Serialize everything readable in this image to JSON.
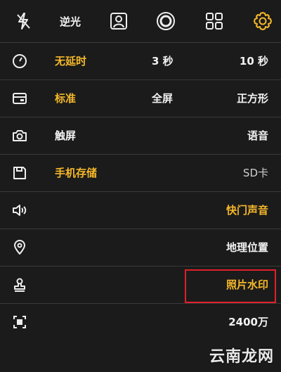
{
  "topbar": {
    "flash_icon": "flash-off-icon",
    "backlight_label": "逆光",
    "portrait_icon": "portrait-icon",
    "shutter_icon": "shutter-ring-icon",
    "grid_icon": "grid-icon",
    "settings_icon": "gear-icon",
    "accent_color": "#f5b82a"
  },
  "rows": {
    "timer": {
      "icon": "timer-icon",
      "options": [
        "无延时",
        "3 秒",
        "10 秒"
      ],
      "selected": 0
    },
    "ratio": {
      "icon": "aspect-ratio-icon",
      "options": [
        "标准",
        "全屏",
        "正方形"
      ],
      "selected": 0
    },
    "capture": {
      "icon": "camera-icon",
      "options": [
        "触屏",
        "语音"
      ],
      "selected": 0
    },
    "storage": {
      "icon": "save-icon",
      "options": [
        "手机存储",
        "SD卡"
      ],
      "selected": 0
    },
    "sound": {
      "icon": "speaker-icon",
      "label": "快门声音"
    },
    "location": {
      "icon": "location-pin-icon",
      "label": "地理位置"
    },
    "watermark": {
      "icon": "stamp-icon",
      "label": "照片水印"
    },
    "resolution": {
      "icon": "resolution-icon",
      "label": "2400万"
    }
  },
  "site_watermark": {
    "part1": "云南",
    "part2": "龙网"
  },
  "colors": {
    "background": "#1b1b1b",
    "active": "#f5b82a",
    "highlight": "#e0202a"
  }
}
